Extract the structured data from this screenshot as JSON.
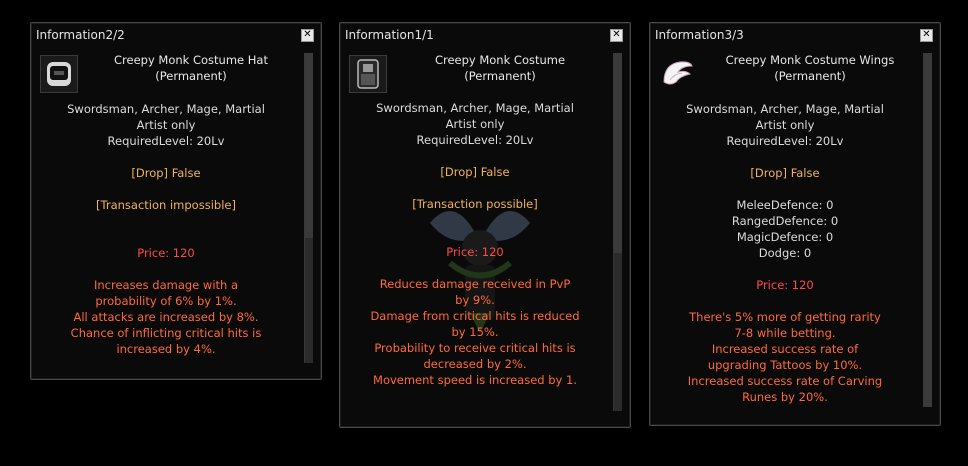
{
  "panels": [
    {
      "title": "Information2/2",
      "icon": "hat-icon",
      "name_line1": "Creepy Monk Costume Hat",
      "name_line2": "(Permanent)",
      "classes": "Swordsman, Archer, Mage, Martial",
      "artist": "Artist only",
      "level": "RequiredLevel: 20Lv",
      "drop": "[Drop] False",
      "transaction": "[Transaction impossible]",
      "stats": [],
      "price": "Price: 120",
      "effects": [
        "Increases damage with a",
        "probability of 6% by 1%.",
        "All attacks are increased by 8%.",
        "Chance of inflicting critical hits is",
        "increased by 4%."
      ]
    },
    {
      "title": "Information1/1",
      "icon": "costume-icon",
      "name_line1": "Creepy Monk Costume",
      "name_line2": "(Permanent)",
      "classes": "Swordsman, Archer, Mage, Martial",
      "artist": "Artist only",
      "level": "RequiredLevel: 20Lv",
      "drop": "[Drop] False",
      "transaction": "[Transaction possible]",
      "stats": [],
      "price": "Price: 120",
      "effects": [
        "Reduces damage received in PvP",
        "by 9%.",
        "Damage from critical hits is reduced",
        "by 15%.",
        "Probability to receive critical hits is",
        "decreased by 2%.",
        "Movement speed is increased by 1."
      ]
    },
    {
      "title": "Information3/3",
      "icon": "wings-icon",
      "name_line1": "Creepy Monk Costume Wings",
      "name_line2": "(Permanent)",
      "classes": "Swordsman, Archer, Mage, Martial",
      "artist": "Artist only",
      "level": "RequiredLevel: 20Lv",
      "drop": "[Drop] False",
      "transaction": "",
      "stats": [
        "MeleeDefence: 0",
        "RangedDefence: 0",
        "MagicDefence: 0",
        "Dodge: 0"
      ],
      "price": "Price: 120",
      "effects": [
        "There's 5% more of getting rarity",
        "7-8 while betting.",
        "Increased success rate of",
        "upgrading Tattoos by 10%.",
        "Increased success rate of Carving",
        "Runes by 20%."
      ]
    }
  ],
  "colors": {
    "white_text": "#dcdcdc",
    "orange_text": "#f0b35a",
    "price_red": "#ff4b4b",
    "effect_orange": "#ff6a3a"
  }
}
